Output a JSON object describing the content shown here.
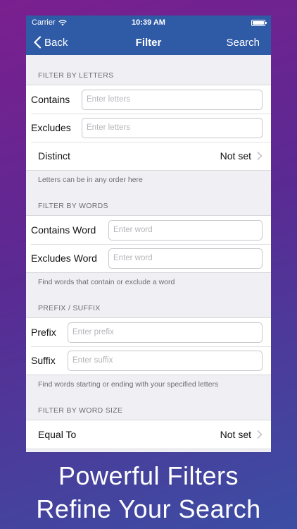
{
  "status": {
    "carrier": "Carrier",
    "time": "10:39 AM"
  },
  "nav": {
    "back": "Back",
    "title": "Filter",
    "search": "Search"
  },
  "letters": {
    "header": "FILTER BY LETTERS",
    "contains_label": "Contains",
    "contains_placeholder": "Enter letters",
    "excludes_label": "Excludes",
    "excludes_placeholder": "Enter letters",
    "distinct_label": "Distinct",
    "distinct_value": "Not set",
    "footer": "Letters can be in any order here"
  },
  "words": {
    "header": "FILTER BY WORDS",
    "contains_label": "Contains Word",
    "contains_placeholder": "Enter word",
    "excludes_label": "Excludes Word",
    "excludes_placeholder": "Enter word",
    "footer": "Find words that contain or exclude a word"
  },
  "affix": {
    "header": "PREFIX / SUFFIX",
    "prefix_label": "Prefix",
    "prefix_placeholder": "Enter prefix",
    "suffix_label": "Suffix",
    "suffix_placeholder": "Enter suffix",
    "footer": "Find words starting or ending with your specified letters"
  },
  "size": {
    "header": "FILTER BY WORD SIZE",
    "equal_label": "Equal To",
    "equal_value": "Not set"
  },
  "caption": {
    "line1": "Powerful Filters",
    "line2": "Refine Your Search"
  },
  "colors": {
    "navbar": "#2f5aa6",
    "background": "#efeff4"
  }
}
